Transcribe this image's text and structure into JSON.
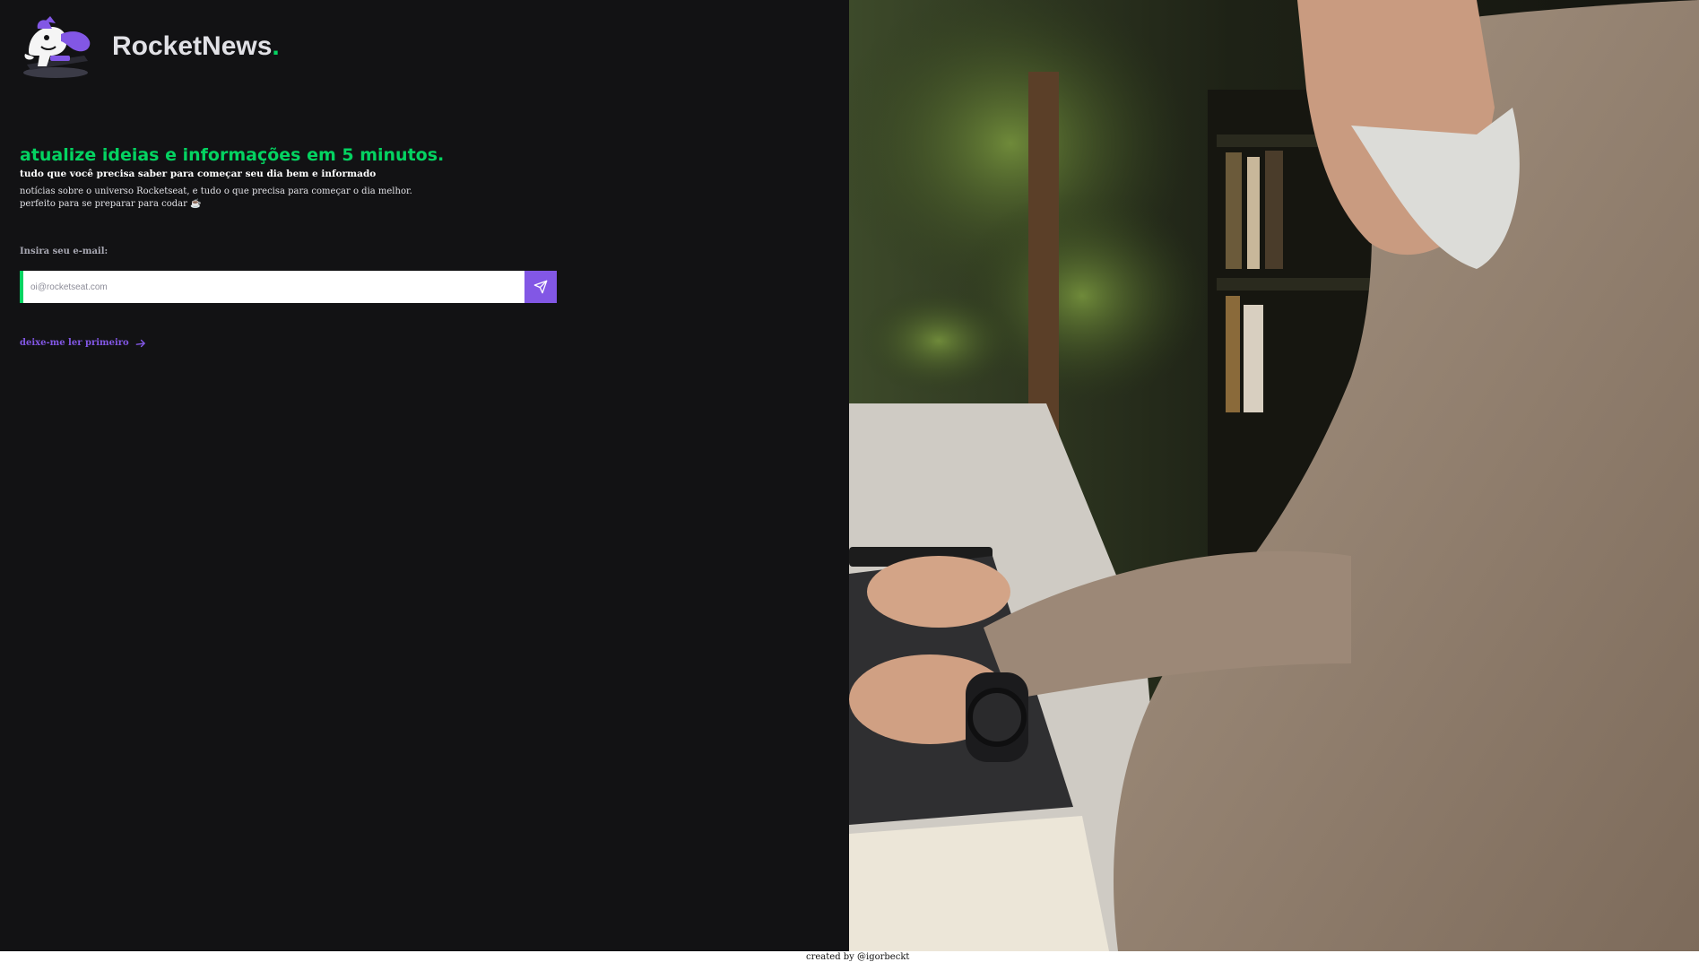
{
  "header": {
    "brand_name": "RocketNews",
    "brand_suffix": ".",
    "logo_icon": "rocket-mascot-icon"
  },
  "hero": {
    "headline": "atualize ideias e informações em 5 minutos.",
    "subheadline": "tudo que você precisa saber para começar seu dia bem e informado",
    "description_line1": "notícias sobre o universo Rocketseat, e tudo o que precisa para começar o dia melhor.",
    "description_line2": "perfeito para se preparar para codar ☕"
  },
  "form": {
    "email_label": "Insira seu e-mail:",
    "email_placeholder": "oi@rocketseat.com",
    "email_value": "",
    "submit_icon": "send-icon"
  },
  "links": {
    "read_first": "deixe-me ler primeiro",
    "read_first_icon": "arrow-right-icon"
  },
  "hero_image": {
    "subject": "man-typing-on-laptop-photo"
  },
  "footer": {
    "credit": "created by @igorbeckt"
  },
  "colors": {
    "background": "#121214",
    "accent_green": "#04d361",
    "accent_purple": "#8257e5",
    "text_light": "#e1e1e6"
  }
}
